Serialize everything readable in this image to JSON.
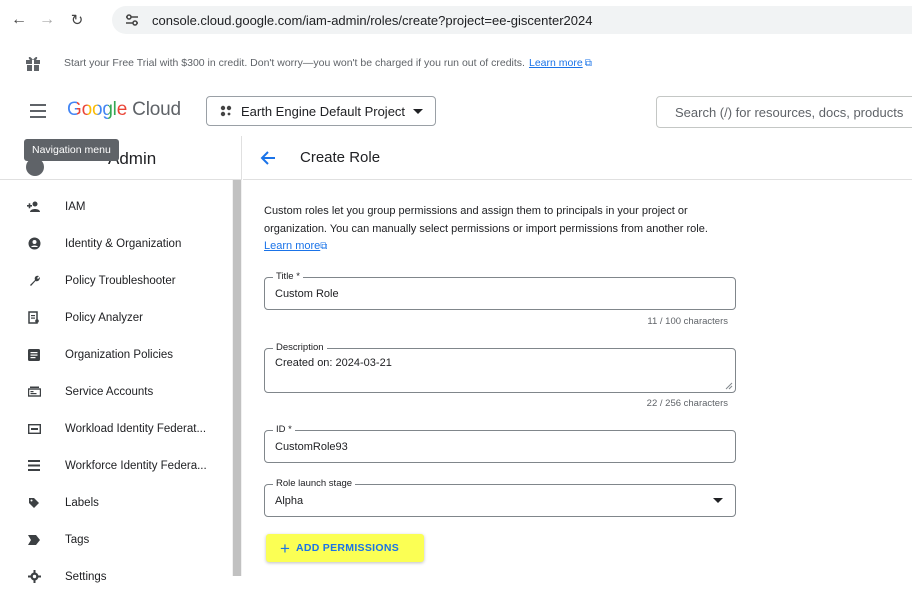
{
  "browser": {
    "url": "console.cloud.google.com/iam-admin/roles/create?project=ee-giscenter2024"
  },
  "banner": {
    "text": "Start your Free Trial with $300 in credit. Don't worry—you won't be charged if you run out of credits.",
    "link": "Learn more"
  },
  "header": {
    "logo_google": "Google",
    "logo_cloud": "Cloud",
    "project": "Earth Engine Default Project",
    "search_placeholder": "Search (/) for resources, docs, products"
  },
  "sidebar": {
    "title": "Admin",
    "tooltip": "Navigation menu",
    "items": [
      {
        "label": "IAM",
        "icon": "person-add-icon"
      },
      {
        "label": "Identity & Organization",
        "icon": "account-circle-icon"
      },
      {
        "label": "Policy Troubleshooter",
        "icon": "wrench-icon"
      },
      {
        "label": "Policy Analyzer",
        "icon": "document-search-icon"
      },
      {
        "label": "Organization Policies",
        "icon": "list-document-icon"
      },
      {
        "label": "Service Accounts",
        "icon": "service-account-icon"
      },
      {
        "label": "Workload Identity Federat...",
        "icon": "id-card-icon"
      },
      {
        "label": "Workforce Identity Federa...",
        "icon": "list-icon"
      },
      {
        "label": "Labels",
        "icon": "label-icon"
      },
      {
        "label": "Tags",
        "icon": "tag-icon"
      },
      {
        "label": "Settings",
        "icon": "gear-icon"
      }
    ]
  },
  "main": {
    "title": "Create Role",
    "intro": "Custom roles let you group permissions and assign them to principals in your project or organization. You can manually select permissions or import permissions from another role.",
    "intro_link": "Learn more",
    "title_field": {
      "label": "Title *",
      "value": "Custom Role",
      "counter": "11 / 100 characters"
    },
    "description_field": {
      "label": "Description",
      "value": "Created on: 2024-03-21",
      "counter": "22 / 256 characters"
    },
    "id_field": {
      "label": "ID *",
      "value": "CustomRole93"
    },
    "stage_field": {
      "label": "Role launch stage",
      "value": "Alpha"
    },
    "add_permissions": "ADD PERMISSIONS"
  },
  "colors": {
    "accent": "#1a73e8",
    "highlight": "#fbff54"
  }
}
